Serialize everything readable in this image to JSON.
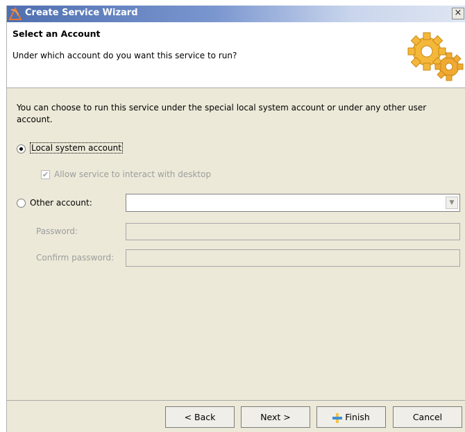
{
  "window": {
    "title": "Create Service Wizard",
    "close_glyph": "×",
    "app_icon": "wizard-logo-icon",
    "header_icon": "gears-icon"
  },
  "header": {
    "title": "Select an Account",
    "subtitle": "Under which account do you want this service to run?"
  },
  "body": {
    "description": "You can choose to run this service under the special local system account or under any other user account.",
    "local_system": {
      "label": "Local system account",
      "selected": true
    },
    "interact_desktop": {
      "label": "Allow service to interact with desktop",
      "checked": true,
      "enabled": false
    },
    "other_account": {
      "label": "Other account:",
      "selected": false,
      "value": ""
    },
    "password": {
      "label": "Password:",
      "value": "",
      "enabled": false
    },
    "confirm_password": {
      "label": "Confirm password:",
      "value": "",
      "enabled": false
    }
  },
  "buttons": {
    "back": "< Back",
    "next": "Next >",
    "finish": "Finish",
    "cancel": "Cancel"
  },
  "colors": {
    "titlebar_start": "#4f6fb0",
    "dialog_bg": "#ece9d8",
    "disabled_text": "#9d9d9d",
    "gear": "#f4b73a"
  }
}
